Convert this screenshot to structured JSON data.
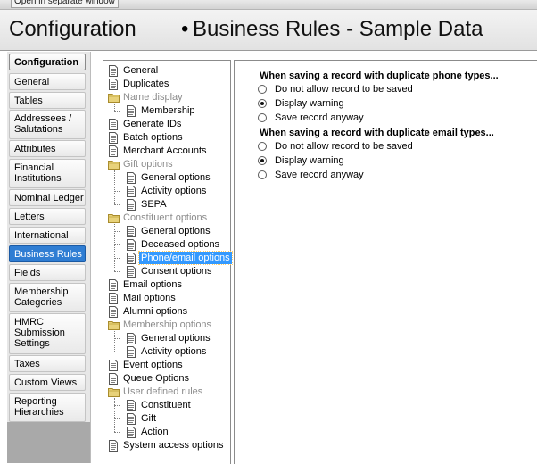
{
  "window": {
    "separate_window_label": "Open in separate window"
  },
  "header": {
    "title": "Configuration",
    "bullet": "•",
    "subtitle": "Business Rules - Sample Data"
  },
  "categories": [
    {
      "label": "Configuration",
      "style": "bold"
    },
    {
      "label": "General"
    },
    {
      "label": "Tables"
    },
    {
      "label": "Addressees / Salutations"
    },
    {
      "label": "Attributes"
    },
    {
      "label": "Financial Institutions"
    },
    {
      "label": "Nominal Ledger"
    },
    {
      "label": "Letters"
    },
    {
      "label": "International"
    },
    {
      "label": "Business Rules",
      "style": "active"
    },
    {
      "label": "Fields"
    },
    {
      "label": "Membership Categories"
    },
    {
      "label": "HMRC Submission Settings"
    },
    {
      "label": "Taxes"
    },
    {
      "label": "Custom Views"
    },
    {
      "label": "Reporting Hierarchies"
    }
  ],
  "tree": [
    {
      "label": "General",
      "type": "page",
      "level": 0
    },
    {
      "label": "Duplicates",
      "type": "page",
      "level": 0
    },
    {
      "label": "Name display",
      "type": "folder",
      "level": 0
    },
    {
      "label": "Membership",
      "type": "page",
      "level": 1
    },
    {
      "label": "Generate IDs",
      "type": "page",
      "level": 0
    },
    {
      "label": "Batch options",
      "type": "page",
      "level": 0
    },
    {
      "label": "Merchant Accounts",
      "type": "page",
      "level": 0
    },
    {
      "label": "Gift options",
      "type": "folder",
      "level": 0
    },
    {
      "label": "General options",
      "type": "page",
      "level": 1
    },
    {
      "label": "Activity options",
      "type": "page",
      "level": 1
    },
    {
      "label": "SEPA",
      "type": "page",
      "level": 1
    },
    {
      "label": "Constituent options",
      "type": "folder",
      "level": 0
    },
    {
      "label": "General options",
      "type": "page",
      "level": 1
    },
    {
      "label": "Deceased options",
      "type": "page",
      "level": 1
    },
    {
      "label": "Phone/email options",
      "type": "page",
      "level": 1,
      "selected": true
    },
    {
      "label": "Consent options",
      "type": "page",
      "level": 1
    },
    {
      "label": "Email options",
      "type": "page",
      "level": 0
    },
    {
      "label": "Mail options",
      "type": "page",
      "level": 0
    },
    {
      "label": "Alumni options",
      "type": "page",
      "level": 0
    },
    {
      "label": "Membership options",
      "type": "folder",
      "level": 0
    },
    {
      "label": "General options",
      "type": "page",
      "level": 1
    },
    {
      "label": "Activity options",
      "type": "page",
      "level": 1
    },
    {
      "label": "Event options",
      "type": "page",
      "level": 0
    },
    {
      "label": "Queue Options",
      "type": "page",
      "level": 0
    },
    {
      "label": "User defined rules",
      "type": "folder",
      "level": 0
    },
    {
      "label": "Constituent",
      "type": "page",
      "level": 1
    },
    {
      "label": "Gift",
      "type": "page",
      "level": 1
    },
    {
      "label": "Action",
      "type": "page",
      "level": 1
    },
    {
      "label": "System access options",
      "type": "page",
      "level": 0
    }
  ],
  "phone_group": {
    "heading": "When saving a record with duplicate phone types...",
    "options": [
      {
        "label": "Do not allow record to be saved",
        "checked": false
      },
      {
        "label": "Display warning",
        "checked": true
      },
      {
        "label": "Save record anyway",
        "checked": false
      }
    ]
  },
  "email_group": {
    "heading": "When saving a record with duplicate email types...",
    "options": [
      {
        "label": "Do not allow record to be saved",
        "checked": false
      },
      {
        "label": "Display warning",
        "checked": true
      },
      {
        "label": "Save record anyway",
        "checked": false
      }
    ]
  },
  "colors": {
    "selection": "#3399ff",
    "active_category": "#2f7dd3",
    "folder": "#e8d27a"
  },
  "icons": {
    "page": "page-icon",
    "folder": "folder-icon"
  }
}
